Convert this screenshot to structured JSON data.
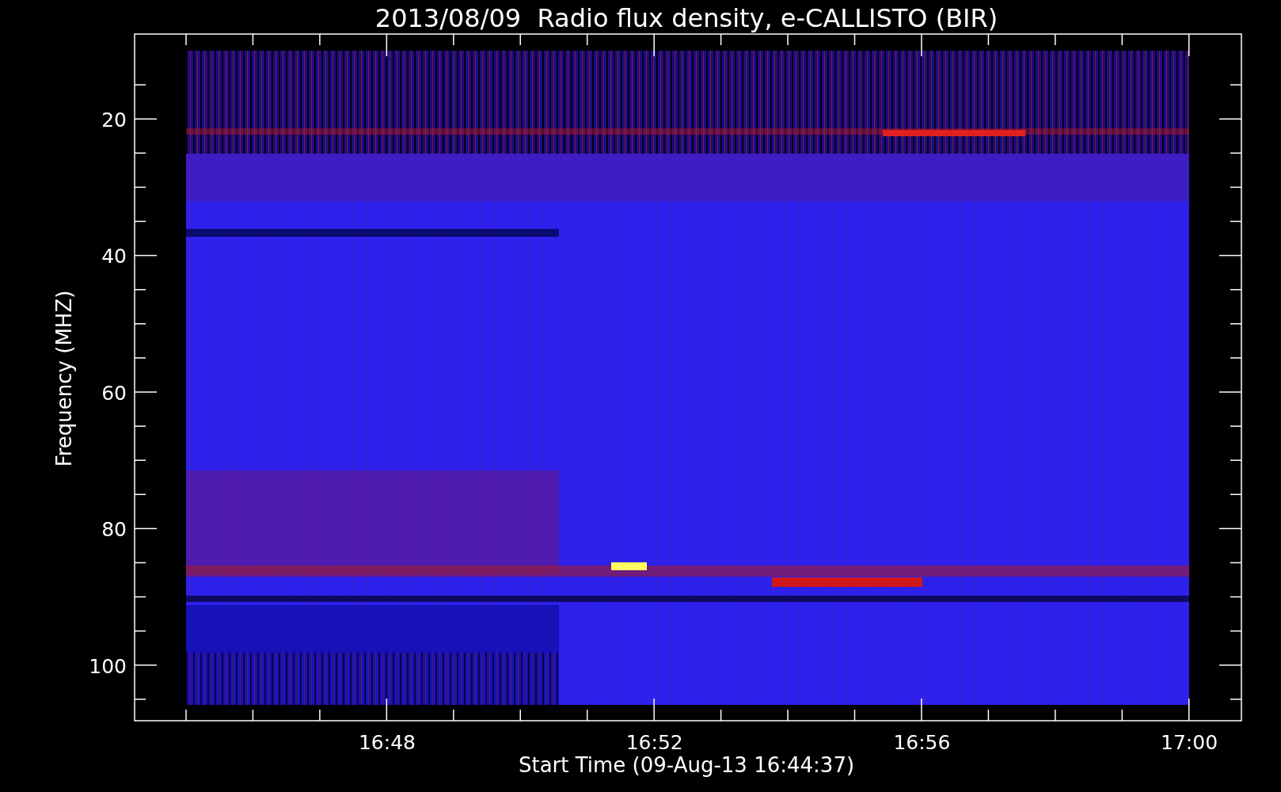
{
  "title": "2013/08/09  Radio flux density, e-CALLISTO (BIR)",
  "y_axis": {
    "label": "Frequency (MHZ)",
    "tick_labels": [
      "20",
      "40",
      "60",
      "80",
      "100"
    ]
  },
  "x_axis": {
    "label": "Start Time (09-Aug-13 16:44:37)",
    "tick_labels": [
      "16:48",
      "16:52",
      "16:56",
      "17:00"
    ]
  }
}
